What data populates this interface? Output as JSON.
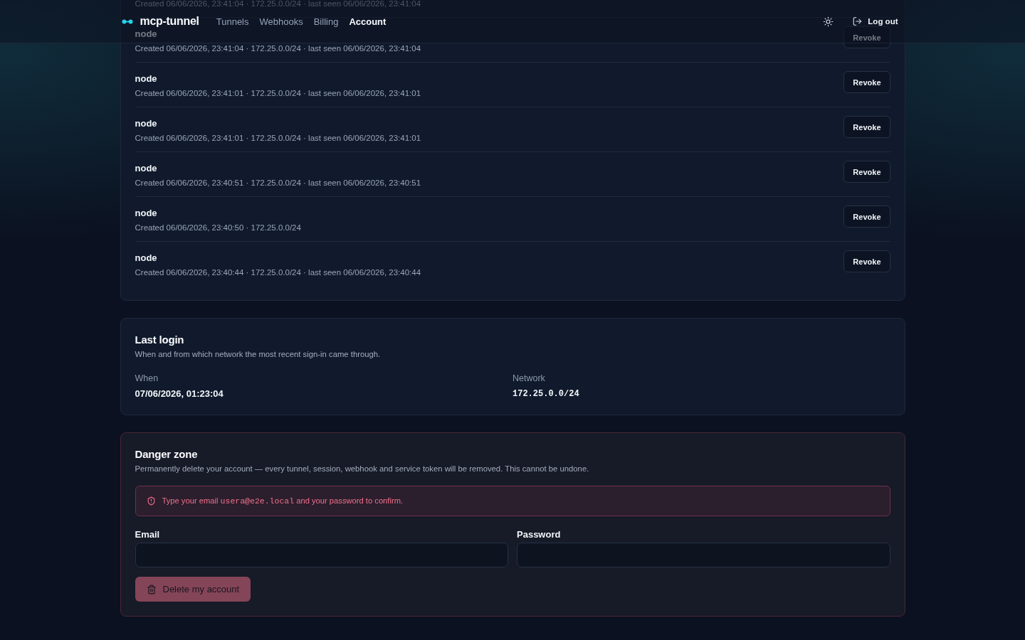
{
  "header": {
    "logo": "mcp-tunnel",
    "nav": [
      {
        "label": "Tunnels",
        "selected": false
      },
      {
        "label": "Webhooks",
        "selected": false
      },
      {
        "label": "Billing",
        "selected": false
      },
      {
        "label": "Account",
        "selected": true
      }
    ],
    "logout": "Log out"
  },
  "tokens": {
    "rows": [
      {
        "meta": "Created 06/06/2026, 23:41:04 · 172.25.0.0/24 · last seen 06/06/2026, 23:41:04"
      },
      {
        "name": "node",
        "meta": "Created 06/06/2026, 23:41:04 · 172.25.0.0/24 · last seen 06/06/2026, 23:41:04",
        "action": "Revoke"
      },
      {
        "name": "node",
        "meta": "Created 06/06/2026, 23:41:01 · 172.25.0.0/24 · last seen 06/06/2026, 23:41:01",
        "action": "Revoke"
      },
      {
        "name": "node",
        "meta": "Created 06/06/2026, 23:41:01 · 172.25.0.0/24 · last seen 06/06/2026, 23:41:01",
        "action": "Revoke"
      },
      {
        "name": "node",
        "meta": "Created 06/06/2026, 23:40:51 · 172.25.0.0/24 · last seen 06/06/2026, 23:40:51",
        "action": "Revoke"
      },
      {
        "name": "node",
        "meta": "Created 06/06/2026, 23:40:50 · 172.25.0.0/24",
        "action": "Revoke"
      },
      {
        "name": "node",
        "meta": "Created 06/06/2026, 23:40:44 · 172.25.0.0/24 · last seen 06/06/2026, 23:40:44",
        "action": "Revoke"
      }
    ]
  },
  "last_login": {
    "title": "Last login",
    "subtitle": "When and from which network the most recent sign-in came through.",
    "fields": [
      {
        "label": "When",
        "value": "07/06/2026, 01:23:04",
        "kind": "text"
      },
      {
        "label": "Network",
        "value": "172.25.0.0/24",
        "kind": "mono"
      }
    ]
  },
  "danger_zone": {
    "title": "Danger zone",
    "subtitle": "Permanently delete your account — every tunnel, session, webhook and service token will be removed. This cannot be undone.",
    "alert": {
      "before": "Type your email",
      "email": "usera@e2e.local",
      "after": "and your password to confirm."
    },
    "fields": [
      {
        "label": "Email"
      },
      {
        "label": "Password"
      }
    ],
    "button": {
      "label": "Delete my account",
      "disabled": true
    }
  }
}
